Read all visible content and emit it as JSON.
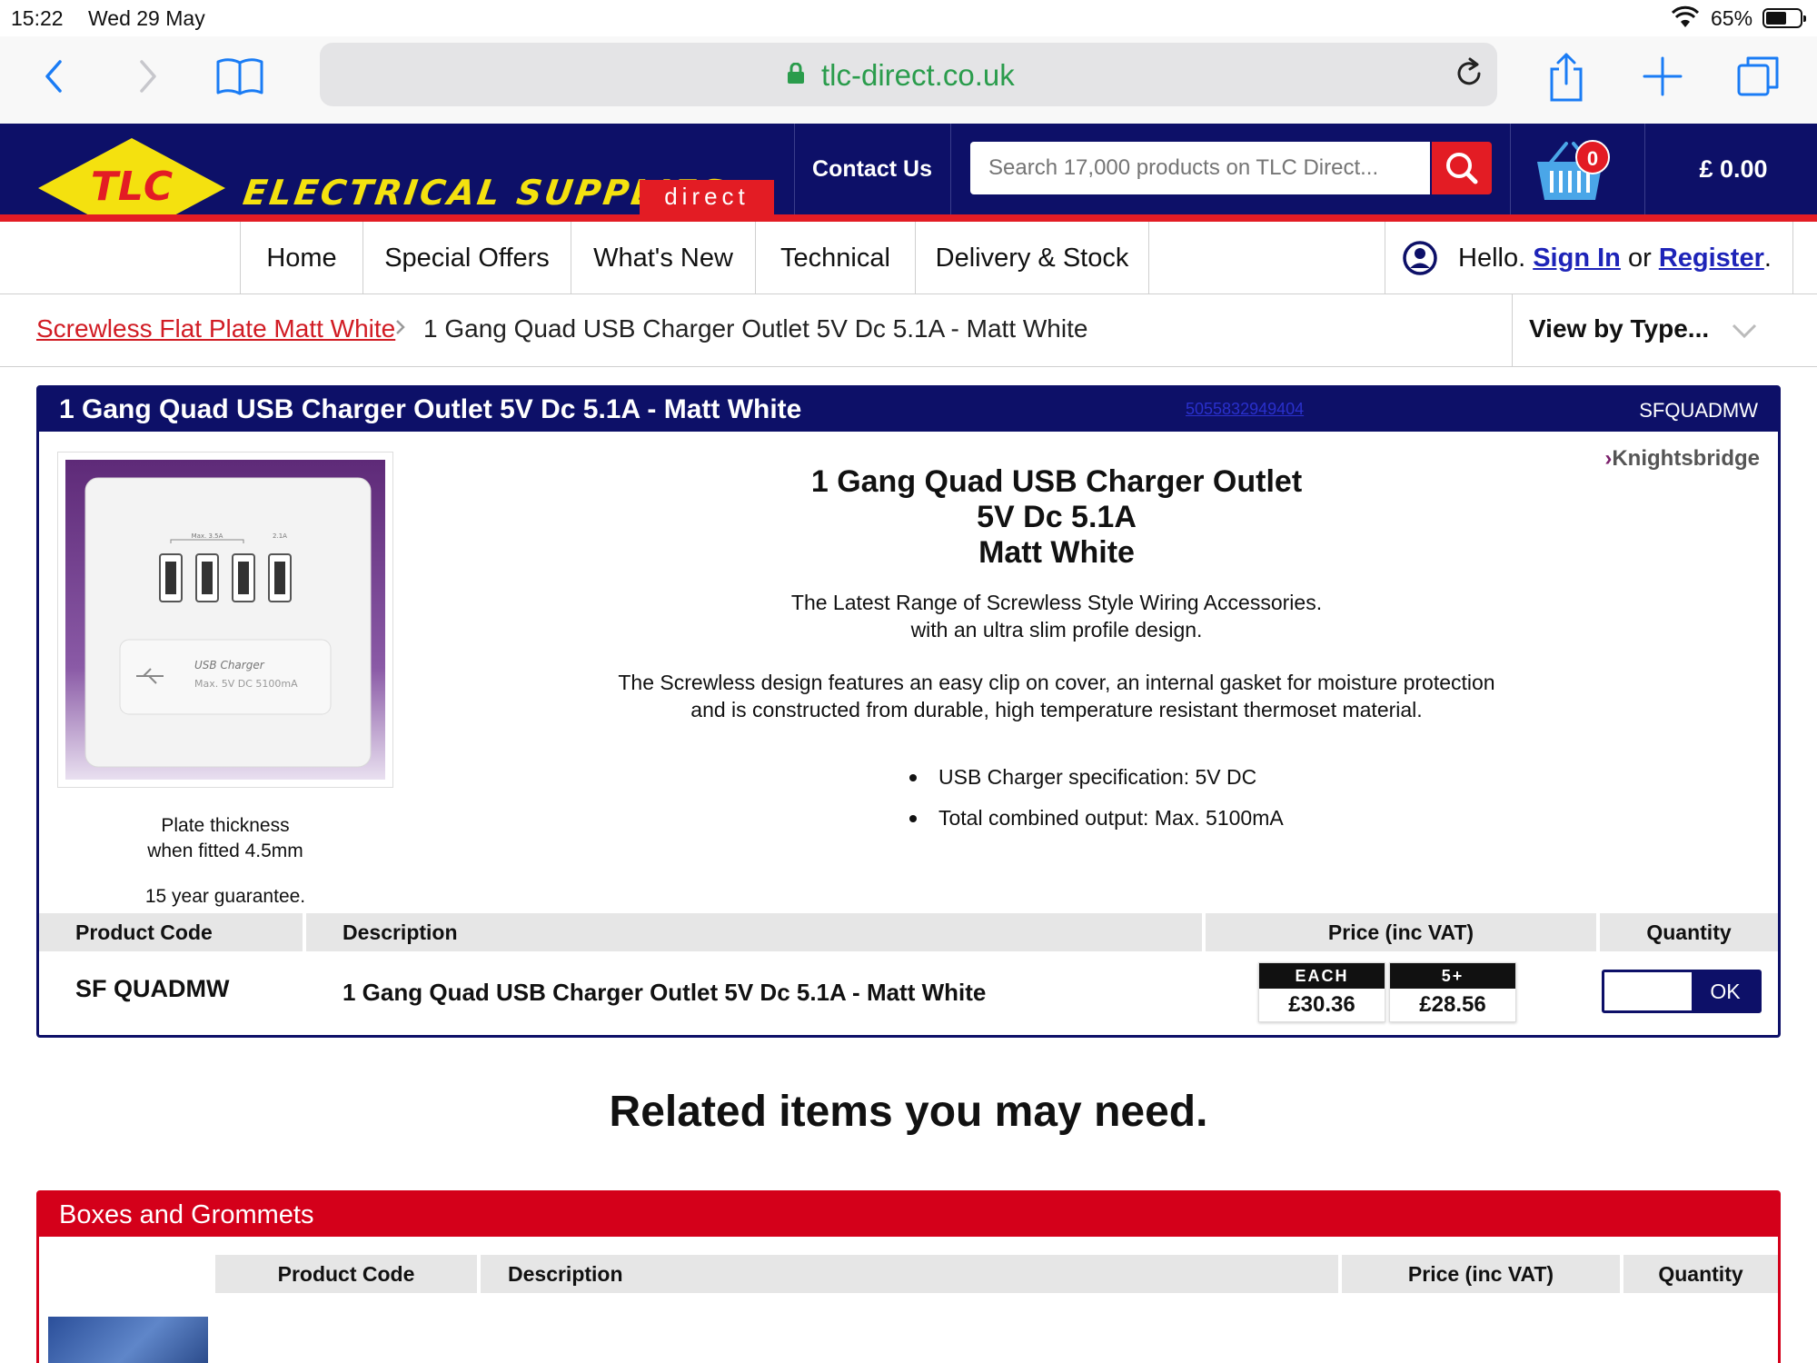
{
  "status": {
    "time": "15:22",
    "date": "Wed 29 May",
    "battery": "65%",
    "battery_level": 0.65
  },
  "browser": {
    "url": "tlc-direct.co.uk"
  },
  "header": {
    "logo_text": "TLC",
    "brand": "ELECTRICAL SUPPLIES",
    "brand_suffix": "direct",
    "contact": "Contact Us",
    "search_placeholder": "Search 17,000 products on TLC Direct...",
    "basket_count": "0",
    "cart_total": "£ 0.00"
  },
  "nav": {
    "items": [
      "Home",
      "Special Offers",
      "What's New",
      "Technical",
      "Delivery & Stock"
    ],
    "hello": "Hello.",
    "sign_in": "Sign In",
    "or": "or",
    "register": "Register",
    "period": "."
  },
  "breadcrumb": {
    "parent": "Screwless Flat Plate Matt White",
    "current": "1 Gang Quad USB Charger Outlet 5V Dc 5.1A - Matt White",
    "view_by": "View by Type..."
  },
  "product": {
    "title": "1 Gang Quad USB Charger Outlet 5V Dc 5.1A - Matt White",
    "ean": "5055832949404",
    "code_header": "SFQUADMW",
    "brand": "Knightsbridge",
    "heading": [
      "1 Gang Quad USB Charger Outlet",
      "5V Dc 5.1A",
      "Matt White"
    ],
    "para1": [
      "The Latest Range of Screwless Style Wiring Accessories.",
      "with an ultra slim profile design."
    ],
    "para2": [
      "The Screwless design features an easy clip on cover, an internal gasket for moisture protection",
      "and is constructed from durable, high temperature resistant thermoset material."
    ],
    "bullets": [
      "USB Charger specification: 5V DC",
      "Total combined output: Max. 5100mA"
    ],
    "caption": [
      "Plate thickness",
      "when fitted 4.5mm"
    ],
    "guarantee": "15 year guarantee.",
    "image_labels": {
      "max": "Max. 3.5A",
      "amp": "2.1A",
      "usb": "USB Charger",
      "spec": "Max. 5V DC 5100mA"
    }
  },
  "table": {
    "headers": [
      "Product Code",
      "Description",
      "Price (inc VAT)",
      "Quantity"
    ],
    "row": {
      "code": "SF QUADMW",
      "desc": "1 Gang Quad USB Charger Outlet 5V Dc 5.1A - Matt White",
      "price_each_label": "EACH",
      "price_each": "£30.36",
      "price_bulk_label": "5+",
      "price_bulk": "£28.56",
      "qty_button": "OK"
    }
  },
  "related": {
    "heading": "Related items you may need.",
    "section_title": "Boxes and Grommets",
    "headers": [
      "Product Code",
      "Description",
      "Price (inc VAT)",
      "Quantity"
    ]
  },
  "colors": {
    "navy": "#0d1068",
    "red": "#e31c24",
    "yellow": "#f4e10f",
    "url_green": "#2a9c4c",
    "link_blue": "#1e24b8"
  }
}
